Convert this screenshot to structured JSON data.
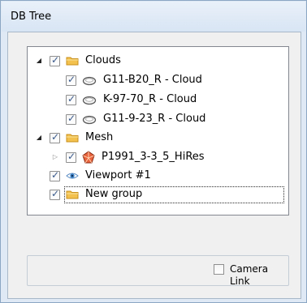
{
  "window": {
    "title": "DB Tree"
  },
  "tree": {
    "items": [
      {
        "label": "Clouds",
        "icon": "folder-icon",
        "expander": "open",
        "checked": true
      },
      {
        "label": "G11-B20_R - Cloud",
        "icon": "cloud-icon",
        "checked": true
      },
      {
        "label": "K-97-70_R - Cloud",
        "icon": "cloud-icon",
        "checked": true
      },
      {
        "label": "G11-9-23_R - Cloud",
        "icon": "cloud-icon",
        "checked": true
      },
      {
        "label": "Mesh",
        "icon": "folder-icon",
        "expander": "open",
        "checked": true
      },
      {
        "label": "P1991_3-3_5_HiRes",
        "icon": "mesh-icon",
        "expander": "closed",
        "checked": true
      },
      {
        "label": "Viewport #1",
        "icon": "eye-icon",
        "checked": true
      },
      {
        "label": "New group",
        "icon": "folder-icon",
        "checked": true,
        "selected": true
      }
    ]
  },
  "bottom": {
    "camera_link_label": "Camera Link",
    "camera_link_checked": false
  },
  "colors": {
    "folder": "#f2c14e",
    "folder_dark": "#d69a1e",
    "checkbox_tick": "#3a5a8c",
    "eye": "#3a7fc4",
    "mesh_red": "#d9502e"
  }
}
